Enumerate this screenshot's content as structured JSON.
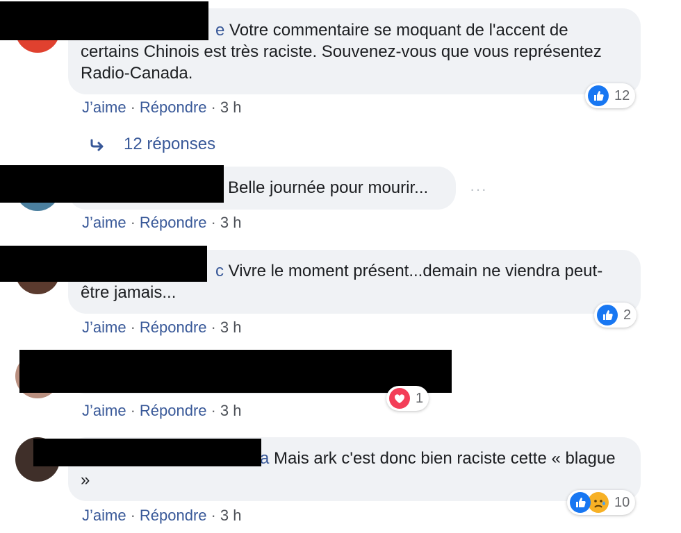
{
  "colors": {
    "link": "#385898",
    "bubble_bg": "#f0f2f5",
    "like_blue": "#1877f2",
    "love_red": "#f33e58",
    "sad_yellow": "#f7b125"
  },
  "comments": [
    {
      "name_frag": "e",
      "text": "Votre commentaire se moquant de l'accent de certains Chinois est très raciste. Souvenez-vous que vous représentez Radio-Canada.",
      "like": "J’aime",
      "reply": "Répondre",
      "time": "3 h",
      "reaction_count": "12",
      "reactions": [
        "like"
      ]
    },
    {
      "name_frag": "",
      "text": "Belle journée pour mourir...",
      "like": "J’aime",
      "reply": "Répondre",
      "time": "3 h",
      "more": "···"
    },
    {
      "name_frag": "c",
      "text": "Vivre le moment présent...demain ne viendra peut-être jamais...",
      "like": "J’aime",
      "reply": "Répondre",
      "time": "3 h",
      "reaction_count": "2",
      "reactions": [
        "like"
      ]
    },
    {
      "name_frag": "",
      "text": "",
      "like": "J’aime",
      "reply": "Répondre",
      "time": "3 h",
      "reaction_count": "1",
      "reactions": [
        "love"
      ]
    },
    {
      "name_frag": "a",
      "text": "Mais ark c'est donc bien raciste cette « blague »",
      "like": "J’aime",
      "reply": "Répondre",
      "time": "3 h",
      "reaction_count": "10",
      "reactions": [
        "like",
        "sad"
      ]
    }
  ],
  "replies_link": {
    "icon": "reply-arrow-icon",
    "label": "12 réponses"
  },
  "separator": "·"
}
